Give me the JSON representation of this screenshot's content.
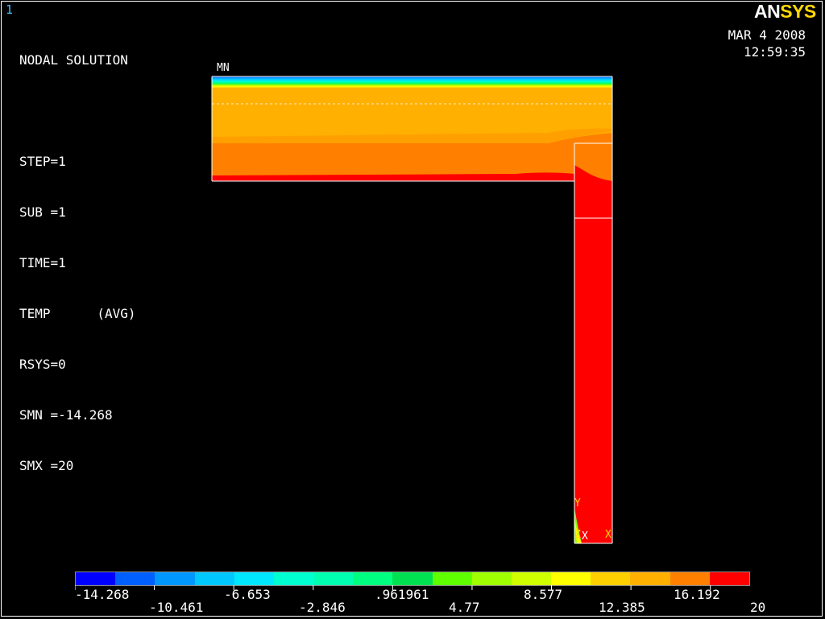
{
  "window_number": "1",
  "logo": {
    "part1": "AN",
    "part2": "SYS"
  },
  "info_lines": [
    "NODAL SOLUTION",
    "",
    "STEP=1",
    "SUB =1",
    "TIME=1",
    "TEMP      (AVG)",
    "RSYS=0",
    "SMN =-14.268",
    "SMX =20"
  ],
  "date": "MAR  4 2008",
  "time": "12:59:35",
  "mn_label": "MN",
  "axis": {
    "y": "Y",
    "z": "Z",
    "x": "X",
    "x2": "X"
  },
  "legend": {
    "colors": [
      "#0000ff",
      "#0060ff",
      "#0098ff",
      "#00c8ff",
      "#00e8ff",
      "#00ffd0",
      "#00ffb0",
      "#00ff80",
      "#00e050",
      "#60ff00",
      "#a0ff00",
      "#d0ff00",
      "#ffff00",
      "#ffd000",
      "#ffb000",
      "#ff8000",
      "#ff0000"
    ],
    "labels_top": [
      "-14.268",
      "-6.653",
      ".961961",
      "8.577",
      "16.192"
    ],
    "labels_bottom": [
      "-10.461",
      "-2.846",
      "4.77",
      "12.385",
      "20"
    ]
  }
}
